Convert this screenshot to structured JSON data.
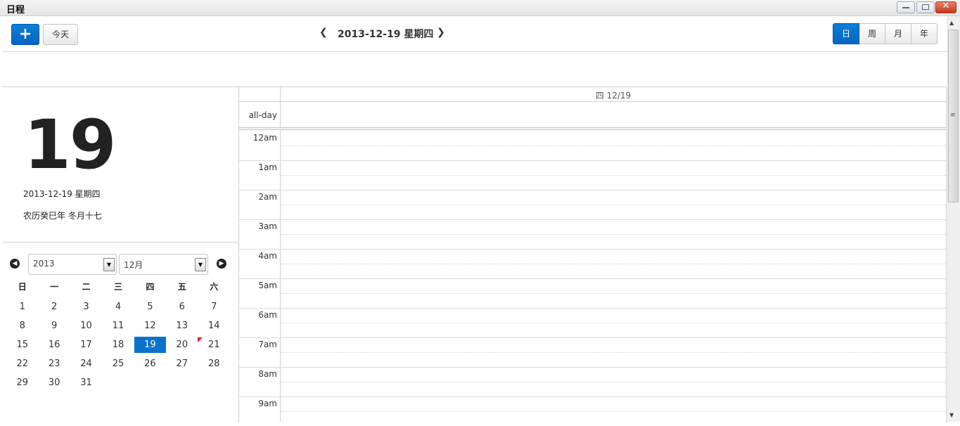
{
  "window": {
    "title": "日程",
    "minimize_icon": "minimize-icon",
    "maximize_icon": "restore-icon",
    "close_icon": "close-icon",
    "close_glyph": "✕"
  },
  "toolbar": {
    "add_label": "+",
    "today_label": "今天",
    "prev_glyph": "❮",
    "next_glyph": "❯",
    "current_date": "2013-12-19 星期四",
    "views": [
      "日",
      "周",
      "月",
      "年"
    ],
    "active_view": "日",
    "accent_color": "#0b72c9"
  },
  "day_panel": {
    "big_day": "19",
    "full_date": "2013-12-19 星期四",
    "lunar": "农历癸巳年 冬月十七"
  },
  "mini_calendar": {
    "year": "2013",
    "month": "12月",
    "prev_glyph": "◀",
    "next_glyph": "▶",
    "select_arrow": "▼",
    "weekdays": [
      "日",
      "一",
      "二",
      "三",
      "四",
      "五",
      "六"
    ],
    "weeks": [
      [
        "1",
        "2",
        "3",
        "4",
        "5",
        "6",
        "7"
      ],
      [
        "8",
        "9",
        "10",
        "11",
        "12",
        "13",
        "14"
      ],
      [
        "15",
        "16",
        "17",
        "18",
        "19",
        "20",
        "21"
      ],
      [
        "22",
        "23",
        "24",
        "25",
        "26",
        "27",
        "28"
      ],
      [
        "29",
        "30",
        "31",
        "",
        "",
        "",
        ""
      ]
    ],
    "selected_day": "19",
    "flagged_day": "21"
  },
  "schedule": {
    "day_header": "四 12/19",
    "allday_label": "all-day",
    "hours": [
      "12am",
      "1am",
      "2am",
      "3am",
      "4am",
      "5am",
      "6am",
      "7am",
      "8am",
      "9am"
    ]
  },
  "scrollbar": {
    "up_glyph": "▲",
    "down_glyph": "▼",
    "grip_glyph": "≡"
  }
}
